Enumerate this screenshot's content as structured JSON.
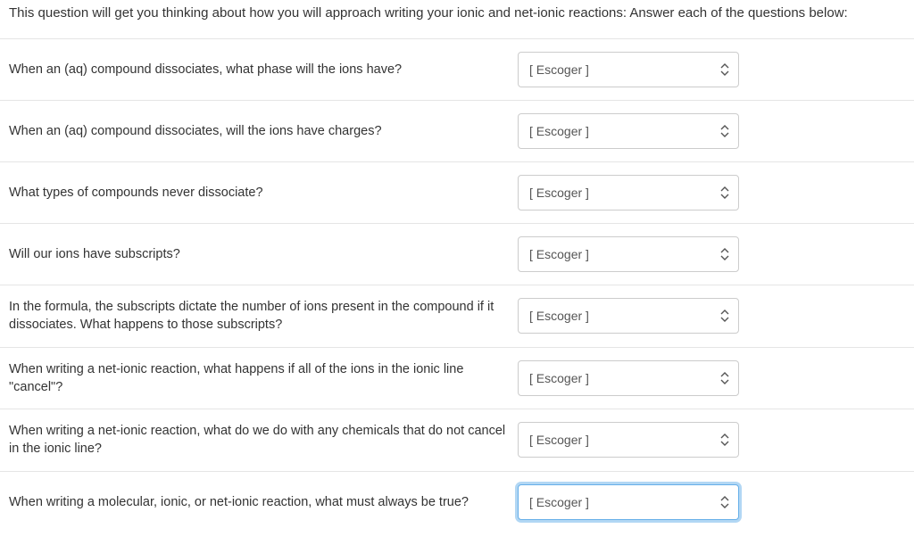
{
  "intro_text": "This question will get you thinking about how you will approach writing your ionic and net-ionic reactions: Answer each of the questions below:",
  "select_placeholder": "[ Escoger ]",
  "questions": [
    {
      "text": "When an (aq) compound dissociates, what phase will the ions have?",
      "focused": false
    },
    {
      "text": "When an (aq) compound dissociates, will the ions have charges?",
      "focused": false
    },
    {
      "text": "What types of compounds never dissociate?",
      "focused": false
    },
    {
      "text": "Will our ions have subscripts?",
      "focused": false
    },
    {
      "text": "In the formula, the subscripts dictate the number of ions present in the compound if it dissociates. What happens to those subscripts?",
      "focused": false
    },
    {
      "text": "When writing a net-ionic reaction, what happens if all of the ions in the ionic line \"cancel\"?",
      "focused": false
    },
    {
      "text": "When writing a net-ionic reaction, what do we do with any chemicals that do not cancel in the ionic line?",
      "focused": false
    },
    {
      "text": "When writing a molecular, ionic, or net-ionic reaction, what must always be true?",
      "focused": true
    }
  ]
}
